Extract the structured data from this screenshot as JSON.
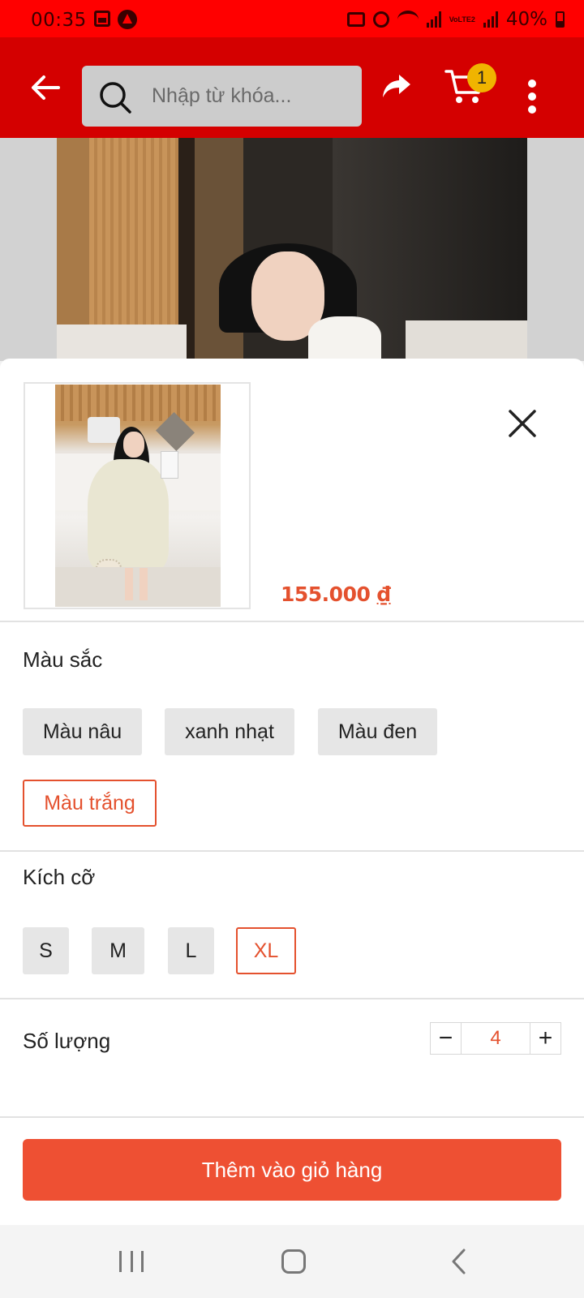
{
  "status_bar": {
    "time": "00:35",
    "battery": "40%",
    "network": "VoLTE2"
  },
  "header": {
    "search_placeholder": "Nhập từ khóa...",
    "cart_count": "1"
  },
  "product": {
    "price": "155.000",
    "currency": "₫"
  },
  "color_section": {
    "label": "Màu sắc",
    "options": [
      "Màu nâu",
      "xanh nhạt",
      "Màu đen",
      "Màu trắng"
    ],
    "selected": "Màu trắng"
  },
  "size_section": {
    "label": "Kích cỡ",
    "options": [
      "S",
      "M",
      "L",
      "XL"
    ],
    "selected": "XL"
  },
  "quantity_section": {
    "label": "Số lượng",
    "minus": "−",
    "plus": "+",
    "value": "4"
  },
  "actions": {
    "add_to_cart": "Thêm vào giỏ hàng"
  },
  "colors": {
    "status_bar": "#ff0000",
    "header": "#d40000",
    "accent": "#ee5033",
    "price": "#e4512e",
    "badge": "#f0b400"
  },
  "icons": [
    "back-arrow-icon",
    "search-icon",
    "share-icon",
    "cart-icon",
    "more-vertical-icon",
    "close-icon",
    "minus-icon",
    "plus-icon"
  ]
}
